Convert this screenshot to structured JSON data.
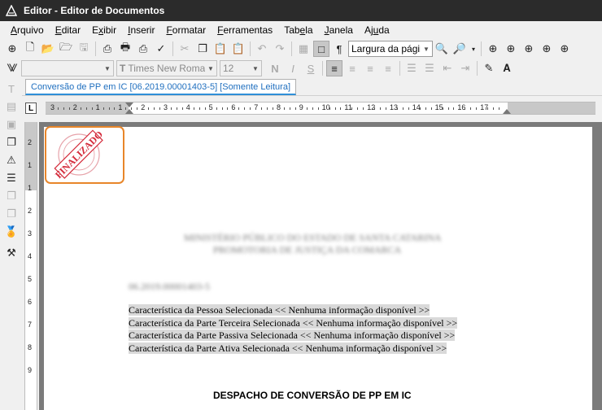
{
  "window": {
    "title": "Editor - Editor de Documentos"
  },
  "menu": [
    {
      "label": "Arquivo",
      "accel_index": 0
    },
    {
      "label": "Editar",
      "accel_index": 0
    },
    {
      "label": "Exibir",
      "accel_index": 1
    },
    {
      "label": "Inserir",
      "accel_index": 0
    },
    {
      "label": "Formatar",
      "accel_index": 0
    },
    {
      "label": "Ferramentas",
      "accel_index": 0
    },
    {
      "label": "Tabela",
      "accel_index": 3
    },
    {
      "label": "Janela",
      "accel_index": 0
    },
    {
      "label": "Ajuda",
      "accel_index": 2
    }
  ],
  "toolbar": {
    "zoom_value": "Largura da págir",
    "style_value": "",
    "font_value": "Times New Romar",
    "size_value": "12",
    "bold": "N",
    "italic": "I",
    "underline": "S"
  },
  "document_tab": {
    "label": "Conversão de PP em IC [06.2019.00001403-5] [Somente Leitura]"
  },
  "ruler": {
    "corner_label": "L",
    "h_numbers": [
      "3",
      "2",
      "1",
      "1",
      "2",
      "3",
      "4",
      "5",
      "6",
      "7",
      "8",
      "9",
      "10",
      "11",
      "12",
      "13",
      "14",
      "15",
      "16",
      "17"
    ],
    "v_numbers": [
      "2",
      "1",
      "1",
      "2",
      "3",
      "4",
      "5",
      "6",
      "7",
      "8",
      "9"
    ]
  },
  "stamp": {
    "text": "FINALIZADO",
    "color": "#d42a3a",
    "border_color": "#e8862a"
  },
  "document": {
    "blurred_header_1": "MINISTÉRIO PÚBLICO DO ESTADO DE SANTA CATARINA",
    "blurred_header_2": "PROMOTORIA DE JUSTIÇA DA COMARCA",
    "blurred_ref": "06.2019.00001403-5",
    "fields": [
      "Característica da Pessoa Selecionada << Nenhuma informação disponível >>",
      "Característica da Parte Terceira Selecionada << Nenhuma informação disponível >>",
      "Característica da Parte Passiva Selecionada << Nenhuma informação disponível >>",
      "Característica da Parte Ativa Selecionada << Nenhuma informação disponível >>"
    ],
    "heading": "DESPACHO DE CONVERSÃO DE PP EM IC"
  }
}
